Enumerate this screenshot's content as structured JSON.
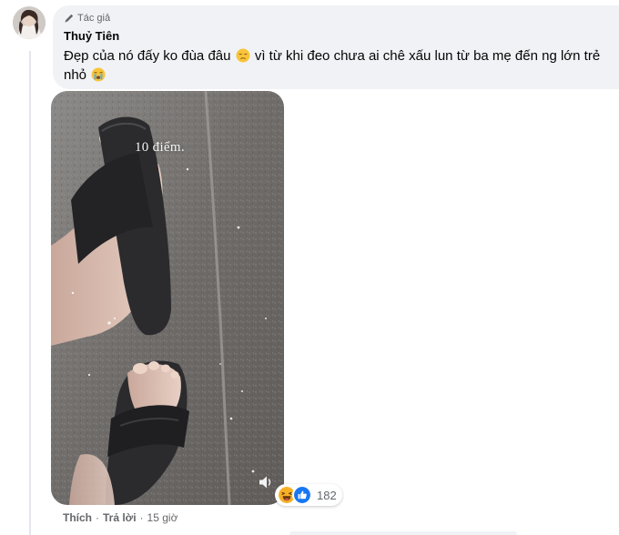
{
  "comment": {
    "author_badge": "Tác giả",
    "author_name": "Thuỷ Tiên",
    "text_part1": "Đẹp của nó đấy ko đùa đâu",
    "text_part2": " vì từ khi đeo chưa ai chê xấu lun từ ba mẹ đến ng lớn trẻ nhỏ",
    "emoji_1": "pensive-face",
    "emoji_2": "crying-face"
  },
  "media": {
    "overlay_text": "10 điểm."
  },
  "reactions": {
    "types": [
      "haha",
      "like"
    ],
    "count": "182"
  },
  "actions": {
    "like_label": "Thích",
    "reply_label": "Trả lời",
    "timestamp": "15 giờ"
  },
  "colors": {
    "bubble": "#f0f2f5",
    "secondary_text": "#65676b",
    "like_blue": "#1877f2",
    "haha_yellow": "#f7b125"
  }
}
